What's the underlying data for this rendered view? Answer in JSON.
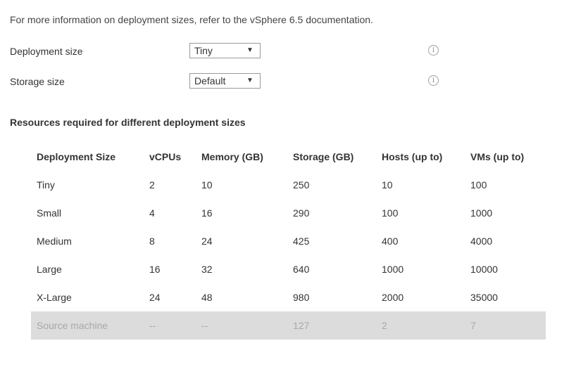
{
  "intro": "For more information on deployment sizes, refer to the vSphere 6.5 documentation.",
  "deployment_size": {
    "label": "Deployment size",
    "selected": "Tiny",
    "arrow": "▼",
    "info_glyph": "i"
  },
  "storage_size": {
    "label": "Storage size",
    "selected": "Default",
    "arrow": "▼",
    "info_glyph": "i"
  },
  "resources": {
    "heading": "Resources required for different deployment sizes",
    "columns": [
      "Deployment Size",
      "vCPUs",
      "Memory (GB)",
      "Storage (GB)",
      "Hosts (up to)",
      "VMs (up to)"
    ],
    "rows": [
      [
        "Tiny",
        "2",
        "10",
        "250",
        "10",
        "100"
      ],
      [
        "Small",
        "4",
        "16",
        "290",
        "100",
        "1000"
      ],
      [
        "Medium",
        "8",
        "24",
        "425",
        "400",
        "4000"
      ],
      [
        "Large",
        "16",
        "32",
        "640",
        "1000",
        "10000"
      ],
      [
        "X-Large",
        "24",
        "48",
        "980",
        "2000",
        "35000"
      ],
      [
        "Source machine",
        "--",
        "--",
        "127",
        "2",
        "7"
      ]
    ]
  },
  "colors": {
    "source_row_bg": "#dcdcdc",
    "source_row_text": "#a8a8a8"
  }
}
